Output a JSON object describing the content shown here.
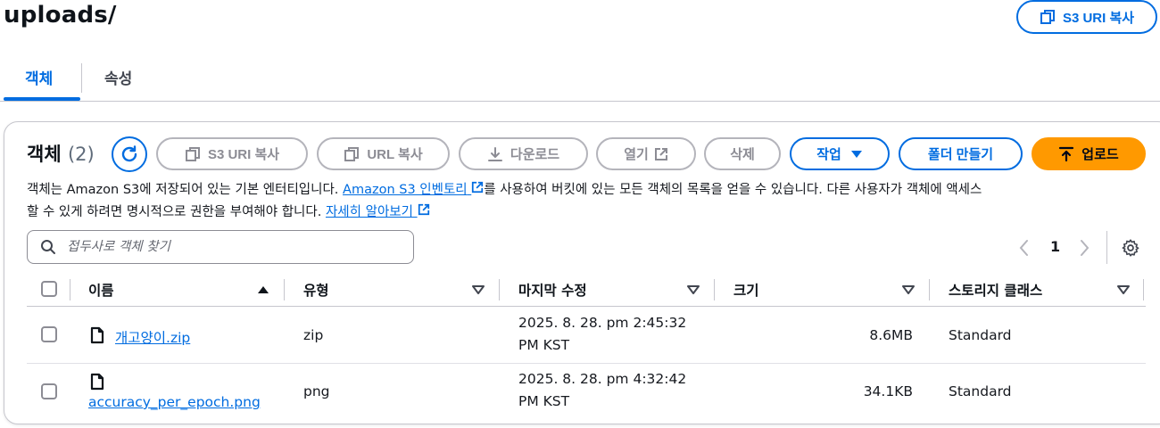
{
  "page": {
    "title": "uploads/",
    "copy_s3_uri_label": "S3 URI 복사"
  },
  "tabs": [
    {
      "label": "객체",
      "active": true
    },
    {
      "label": "속성",
      "active": false
    }
  ],
  "objects": {
    "title": "객체",
    "count": "(2)",
    "actions": {
      "copy_s3_uri": "S3 URI 복사",
      "copy_url": "URL 복사",
      "download": "다운로드",
      "open": "열기",
      "delete": "삭제",
      "actions_menu": "작업",
      "create_folder": "폴더 만들기",
      "upload": "업로드"
    },
    "description": {
      "part1": "객체는 Amazon S3에 저장되어 있는 기본 엔터티입니다.",
      "inventory_link": "Amazon S3 인벤토리",
      "part2": "를 사용하여 버킷에 있는 모든 객체의 목록을 얻을 수 있습니다. 다른 사용자가 객체에 액세스",
      "line2": "할 수 있게 하려면 명시적으로 권한을 부여해야 합니다.",
      "learn_more_link": "자세히 알아보기"
    },
    "search_placeholder": "접두사로 객체 찾기",
    "page_number": "1",
    "columns": {
      "name": "이름",
      "type": "유형",
      "modified": "마지막 수정",
      "size": "크기",
      "storage": "스토리지 클래스"
    },
    "rows": [
      {
        "name": "개고양이.zip",
        "type": "zip",
        "modified_l1": "2025. 8. 28. pm 2:45:32",
        "modified_l2": "PM KST",
        "size": "8.6MB",
        "storage": "Standard"
      },
      {
        "name": "accuracy_per_epoch.png",
        "type": "png",
        "modified_l1": "2025. 8. 28. pm 4:32:42",
        "modified_l2": "PM KST",
        "size": "34.1KB",
        "storage": "Standard"
      }
    ]
  },
  "colors": {
    "accent": "#006ce0",
    "primary_button": "#ff9900",
    "border": "#c6c6cd",
    "disabled": "#b4b4bb"
  }
}
